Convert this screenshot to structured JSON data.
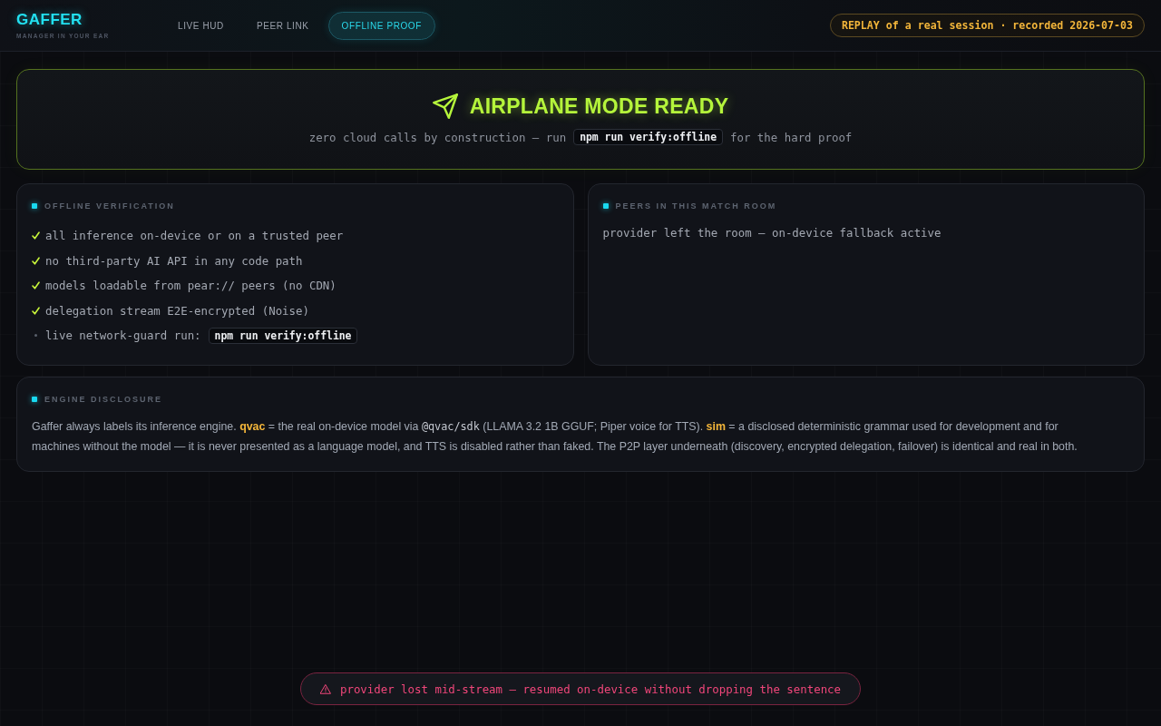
{
  "header": {
    "brand": {
      "title": "GAFFER",
      "tagline": "MANAGER IN YOUR EAR"
    },
    "tabs": [
      {
        "label": "LIVE HUD",
        "selected": false
      },
      {
        "label": "PEER LINK",
        "selected": false
      },
      {
        "label": "OFFLINE PROOF",
        "selected": true
      }
    ],
    "replay_badge": "REPLAY of a real session · recorded 2026-07-03"
  },
  "hero": {
    "title": "AIRPLANE MODE READY",
    "subtitle": {
      "before": "zero cloud calls by construction — run",
      "code": "npm run verify:offline",
      "after": "for the hard proof"
    }
  },
  "offline_verification": {
    "heading": "OFFLINE VERIFICATION",
    "items": [
      {
        "text": "all inference on-device or on a trusted peer",
        "checked": true
      },
      {
        "text": "no third-party AI API in any code path",
        "checked": true
      },
      {
        "text": "models loadable from pear:// peers (no CDN)",
        "checked": true
      },
      {
        "text": "delegation stream E2E-encrypted (Noise)",
        "checked": true
      },
      {
        "text": "live network-guard run:",
        "code": "npm run verify:offline",
        "checked": false
      }
    ]
  },
  "peers": {
    "heading": "PEERS IN THIS MATCH ROOM",
    "message": "provider left the room — on-device fallback active"
  },
  "engine_disclosure": {
    "heading": "ENGINE DISCLOSURE",
    "segments": [
      {
        "kind": "text",
        "text": "Gaffer always labels its inference engine. "
      },
      {
        "kind": "term",
        "text": "qvac"
      },
      {
        "kind": "text",
        "text": " = the real on-device model via "
      },
      {
        "kind": "code",
        "text": "@qvac/sdk"
      },
      {
        "kind": "text",
        "text": " (LLAMA 3.2 1B GGUF; Piper voice for TTS). "
      },
      {
        "kind": "term",
        "text": "sim"
      },
      {
        "kind": "text",
        "text": " = a disclosed deterministic grammar used for development and for machines without the model — it is never presented as a language model, and TTS is disabled rather than faked. The P2P layer underneath (discovery, encrypted delegation, failover) is identical and real in both."
      }
    ]
  },
  "toast": {
    "message": "provider lost mid-stream — resumed on-device without dropping the sentence"
  }
}
